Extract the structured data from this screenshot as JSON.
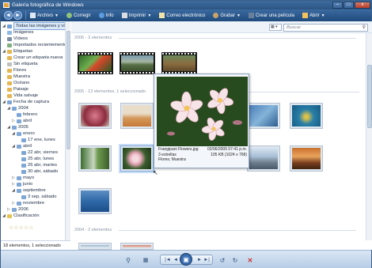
{
  "window": {
    "title": "Galería fotográfica de Windows"
  },
  "window_controls": {
    "minimize": "–",
    "maximize": "□",
    "close": "x"
  },
  "toolbar": {
    "back": "◄",
    "forward": "►",
    "file": "Archivo",
    "fix": "Corregir",
    "info": "Info",
    "print": "Imprimir",
    "email": "Correo electrónico",
    "burn": "Grabar",
    "movie": "Crear una película",
    "open": "Abrir"
  },
  "sidebar": {
    "items": [
      {
        "label": "Todas las imágenes y vídeos",
        "icon": "photos-icon"
      },
      {
        "label": "Imágenes",
        "icon": "image-icon"
      },
      {
        "label": "Vídeos",
        "icon": "video-icon"
      },
      {
        "label": "Importados recientemente",
        "icon": "import-icon"
      },
      {
        "label": "Etiquetas",
        "icon": "tag-icon"
      },
      {
        "label": "Crear un etiqueta nueva",
        "icon": "tag-add-icon"
      },
      {
        "label": "Sin etiqueta",
        "icon": "tag-icon"
      },
      {
        "label": "Flores",
        "icon": "tag-icon"
      },
      {
        "label": "Muestra",
        "icon": "tag-icon"
      },
      {
        "label": "Océano",
        "icon": "tag-icon"
      },
      {
        "label": "Paisaje",
        "icon": "tag-icon"
      },
      {
        "label": "Vida salvaje",
        "icon": "tag-icon"
      },
      {
        "label": "Fecha de captura",
        "icon": "calendar-icon"
      },
      {
        "label": "2004",
        "icon": "calendar-icon"
      },
      {
        "label": "febrero",
        "icon": "calendar-icon"
      },
      {
        "label": "abril",
        "icon": "calendar-icon"
      },
      {
        "label": "2005",
        "icon": "calendar-icon"
      },
      {
        "label": "enero",
        "icon": "calendar-icon"
      },
      {
        "label": "17 ene, lunes",
        "icon": "calendar-icon"
      },
      {
        "label": "abril",
        "icon": "calendar-icon"
      },
      {
        "label": "22 abr, viernes",
        "icon": "calendar-icon"
      },
      {
        "label": "25 abr, lunes",
        "icon": "calendar-icon"
      },
      {
        "label": "26 abr, martes",
        "icon": "calendar-icon"
      },
      {
        "label": "30 abr, sábado",
        "icon": "calendar-icon"
      },
      {
        "label": "mayo",
        "icon": "calendar-icon"
      },
      {
        "label": "junio",
        "icon": "calendar-icon"
      },
      {
        "label": "septiembre",
        "icon": "calendar-icon"
      },
      {
        "label": "3 sep, sábado",
        "icon": "calendar-icon"
      },
      {
        "label": "noviembre",
        "icon": "calendar-icon"
      },
      {
        "label": "2006",
        "icon": "calendar-icon"
      },
      {
        "label": "Clasificación",
        "icon": "star-icon"
      }
    ],
    "stars": "☆☆☆☆☆"
  },
  "status": {
    "text": "18 elementos, 1 seleccionado"
  },
  "search": {
    "placeholder": "Buscar"
  },
  "groups": {
    "g2006": "2006 - 3 elementos",
    "g2005": "2005 - 13 elementos, 1 seleccionado",
    "g2004": "2004 - 2 elementos"
  },
  "preview": {
    "filename": "Frangipani Flowers.jpg",
    "date": "02/06/2005 07:41 p.m.",
    "rating": "3 estrellas",
    "size": "105 KB (1024 x 768)",
    "tags": "Flores; Muestra"
  },
  "bottombar": {
    "zoom": "⚲",
    "grid": "▦",
    "first": "|◄",
    "prev": "◄",
    "slideshow": "▣",
    "next": "►",
    "last": "►|",
    "rotate_left": "↺",
    "rotate_right": "↻",
    "delete": "✕"
  },
  "colors": {
    "accent": "#2c5584",
    "selection": "#c7dcf4",
    "delete": "#d22b2b"
  }
}
